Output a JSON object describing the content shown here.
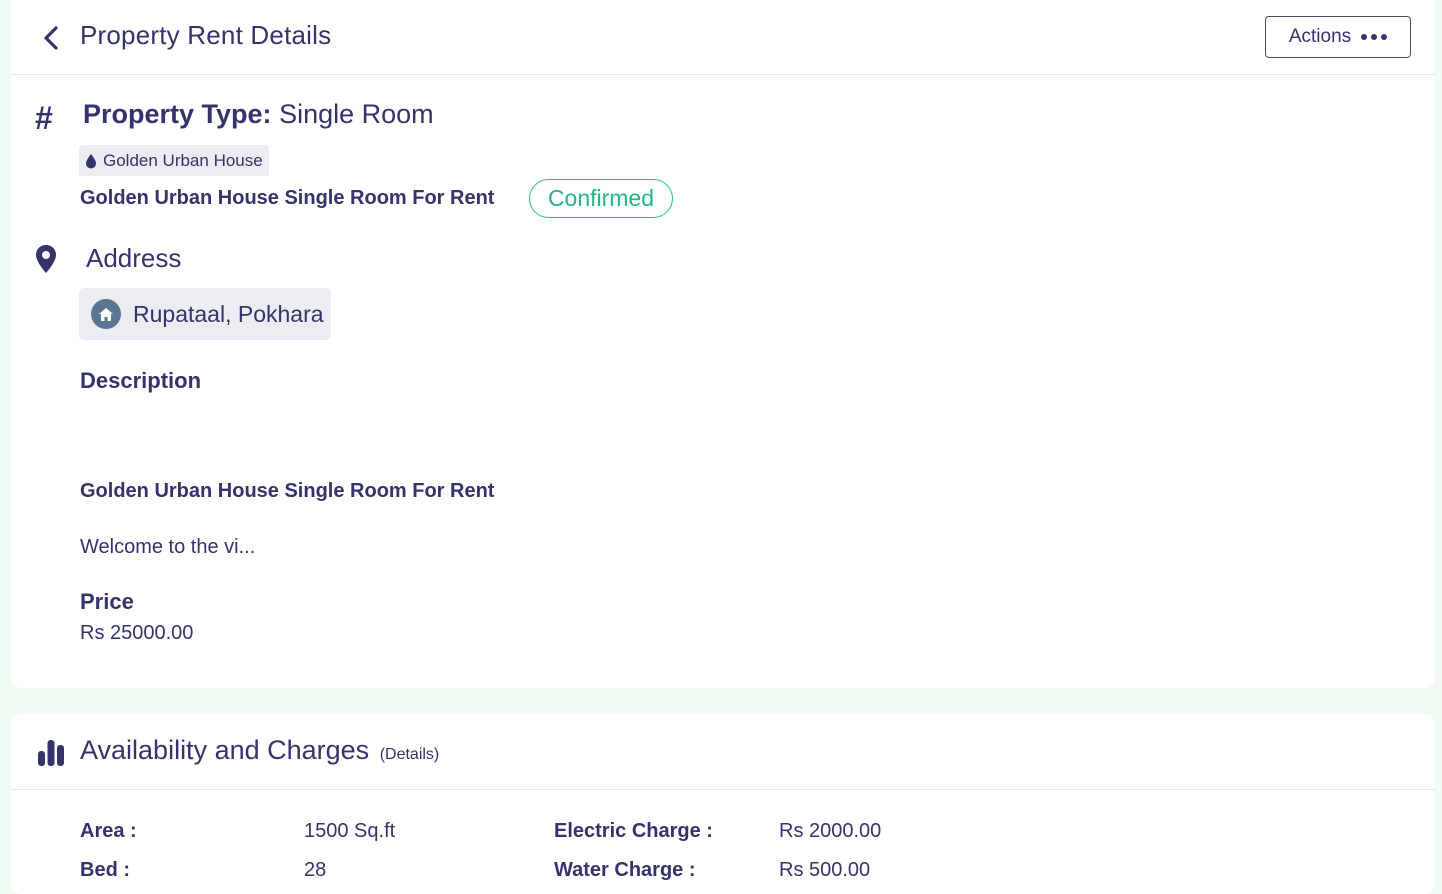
{
  "header": {
    "title": "Property Rent Details",
    "actions_label": "Actions"
  },
  "property": {
    "type_label": "Property Type:",
    "type_value": "Single Room",
    "tag": "Golden Urban House",
    "listing_title": "Golden Urban House Single Room For Rent",
    "status": "Confirmed"
  },
  "address": {
    "heading": "Address",
    "value": "Rupataal, Pokhara"
  },
  "description": {
    "heading": "Description",
    "title": "Golden Urban House Single Room For Rent",
    "text": "Welcome to the vi..."
  },
  "price": {
    "label": "Price",
    "value": "Rs 25000.00"
  },
  "availability": {
    "title": "Availability and Charges",
    "subtitle": "(Details)",
    "rows": [
      {
        "label": "Area :",
        "value": "1500 Sq.ft"
      },
      {
        "label": "Bed :",
        "value": "28"
      }
    ],
    "charges": [
      {
        "label": "Electric Charge :",
        "value": "Rs 2000.00"
      },
      {
        "label": "Water Charge :",
        "value": "Rs 500.00"
      }
    ]
  },
  "colors": {
    "primary_text": "#35336b",
    "status_green": "#1fb97f",
    "page_bg": "#f1fbf4",
    "chip_bg": "#ececf3"
  },
  "icons": [
    "chevron-left-icon",
    "more-dots-icon",
    "hash-icon",
    "drop-icon",
    "map-pin-icon",
    "home-icon",
    "bar-chart-icon"
  ]
}
